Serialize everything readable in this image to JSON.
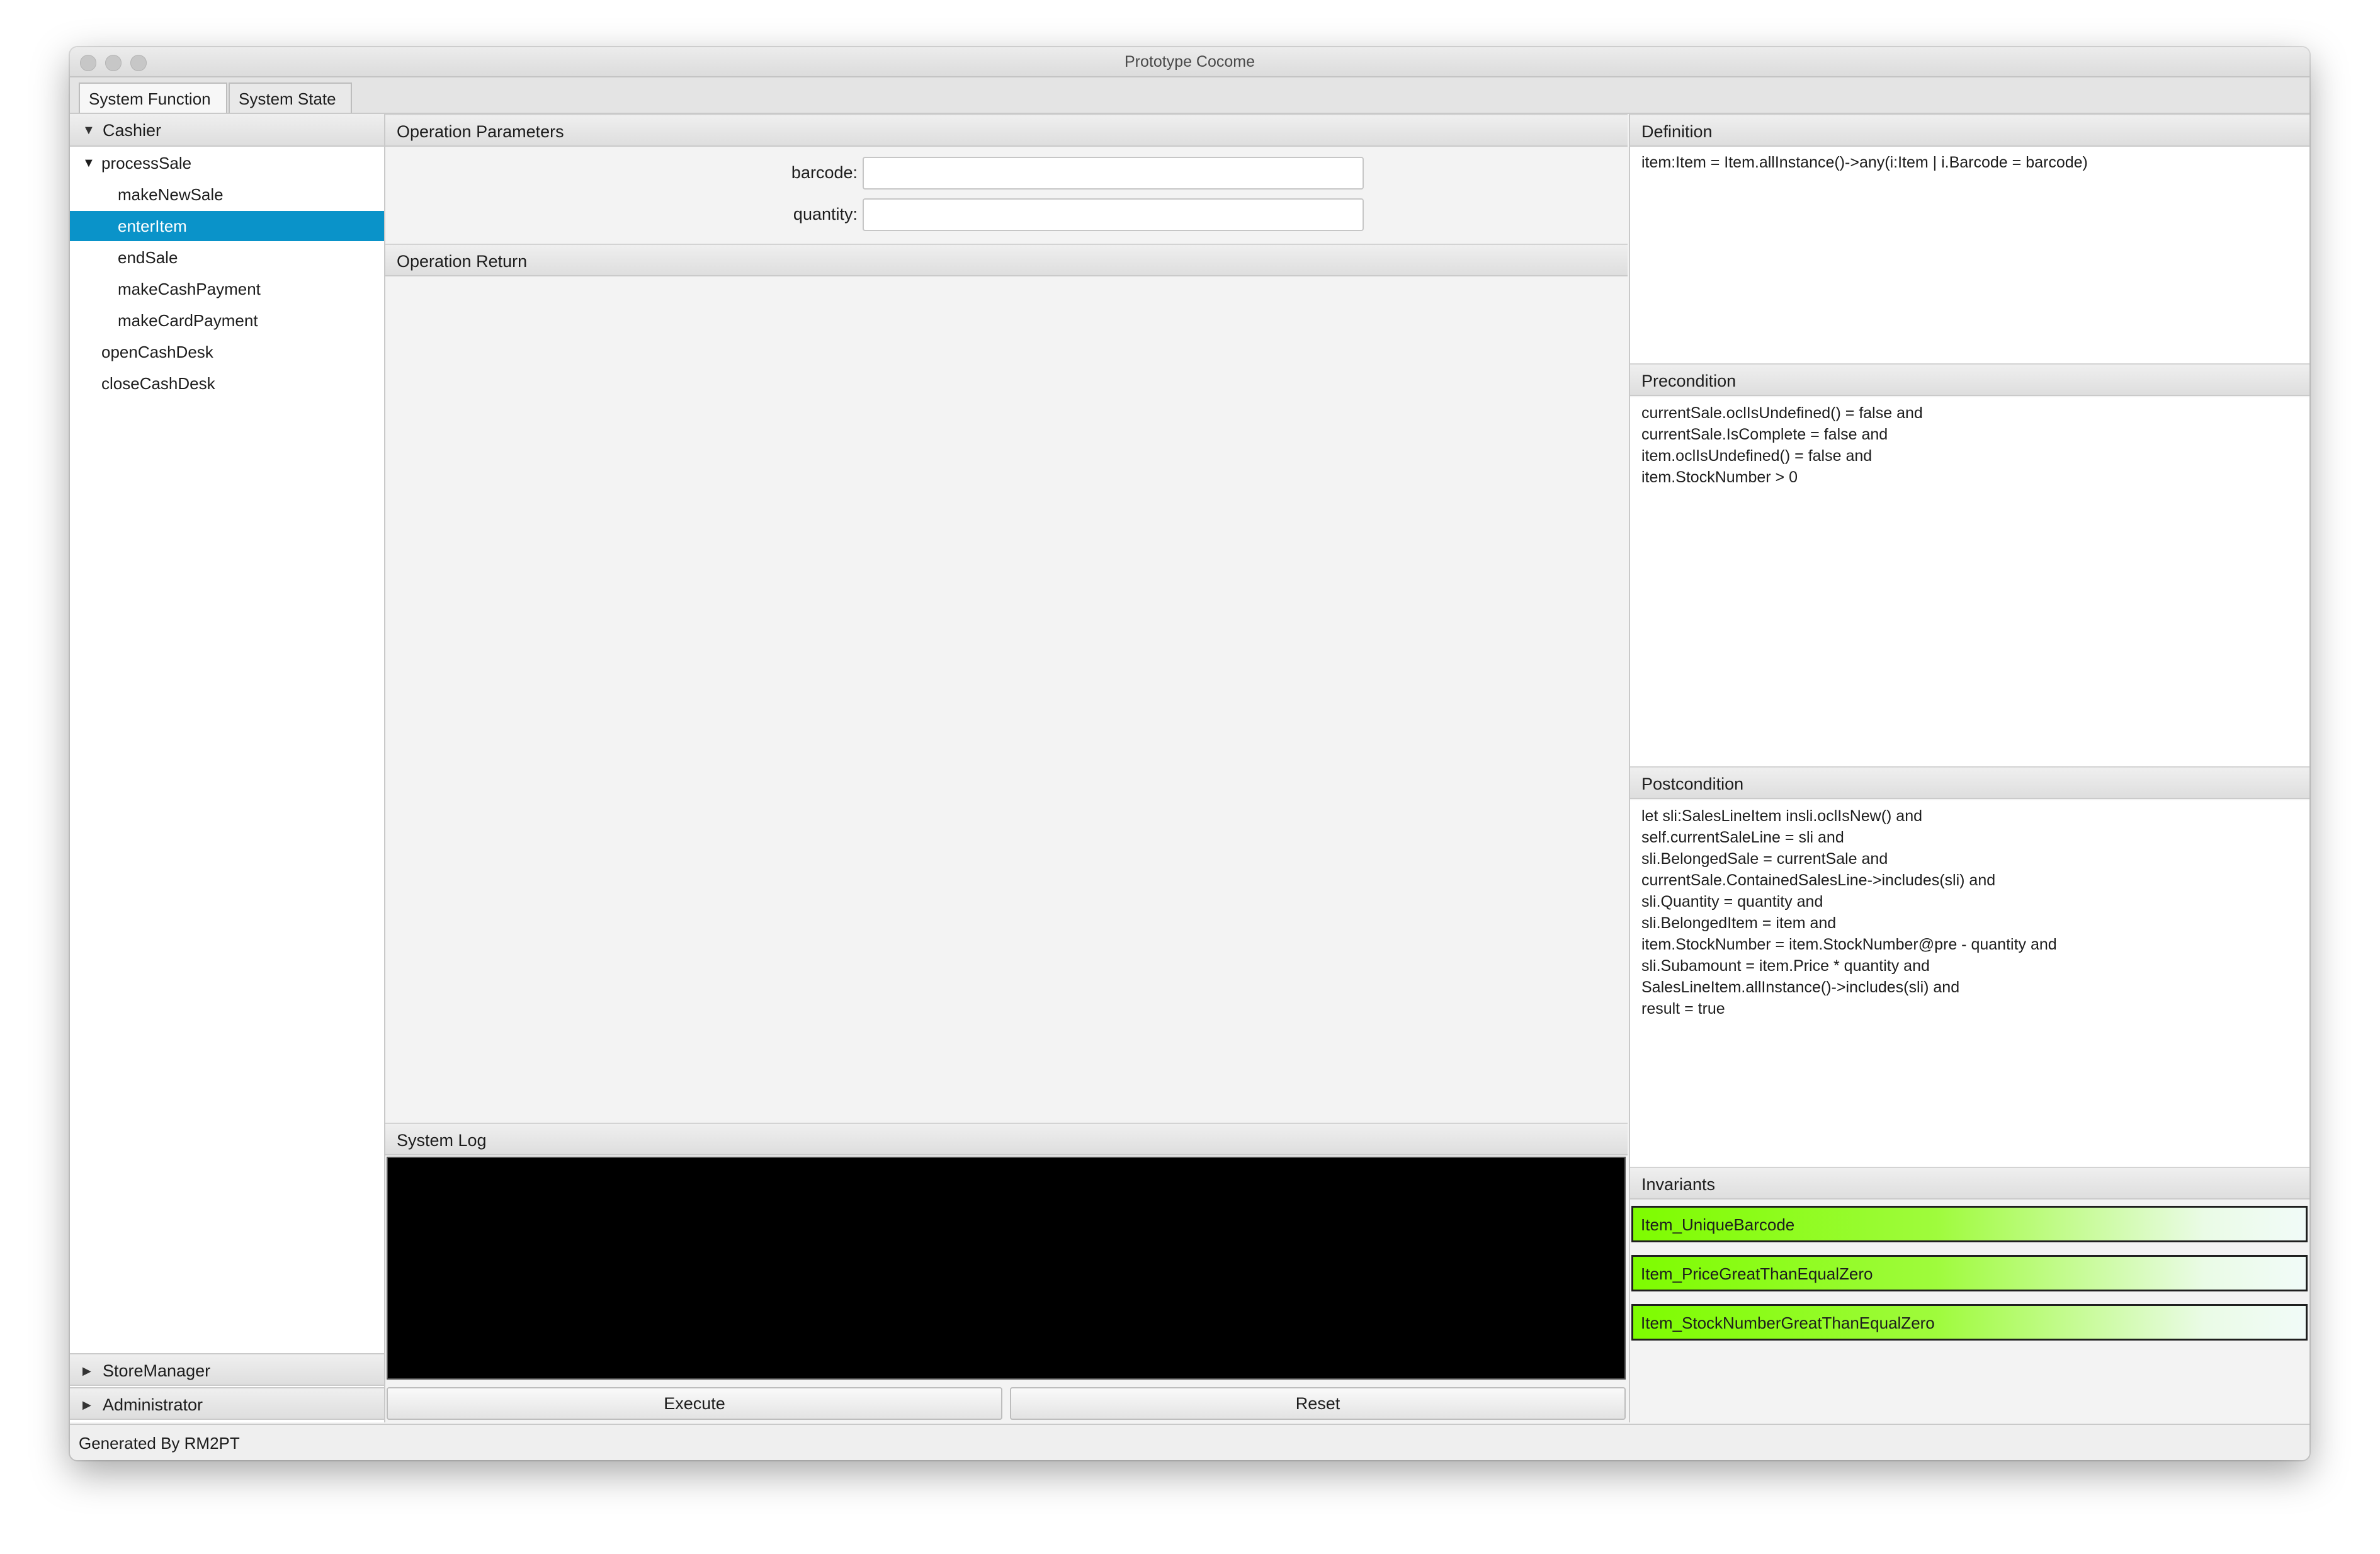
{
  "window": {
    "title": "Prototype Cocome"
  },
  "tabs": [
    {
      "label": "System Function",
      "active": true
    },
    {
      "label": "System State",
      "active": false
    }
  ],
  "tree": {
    "cashier": "Cashier",
    "processSale": "processSale",
    "items": [
      "makeNewSale",
      "enterItem",
      "endSale",
      "makeCashPayment",
      "makeCardPayment"
    ],
    "selected": "enterItem",
    "openCashDesk": "openCashDesk",
    "closeCashDesk": "closeCashDesk",
    "storeManager": "StoreManager",
    "administrator": "Administrator"
  },
  "operation": {
    "parameters_title": "Operation Parameters",
    "barcode_label": "barcode:",
    "barcode_value": "",
    "quantity_label": "quantity:",
    "quantity_value": "",
    "return_title": "Operation Return",
    "log_title": "System Log",
    "execute": "Execute",
    "reset": "Reset"
  },
  "definition": {
    "title": "Definition",
    "text": "item:Item = Item.allInstance()->any(i:Item | i.Barcode = barcode)"
  },
  "precondition": {
    "title": "Precondition",
    "text": "currentSale.oclIsUndefined() = false and\ncurrentSale.IsComplete = false and\nitem.oclIsUndefined() = false and\nitem.StockNumber > 0"
  },
  "postcondition": {
    "title": "Postcondition",
    "text": "let sli:SalesLineItem insli.oclIsNew() and\nself.currentSaleLine = sli and\nsli.BelongedSale = currentSale and\ncurrentSale.ContainedSalesLine->includes(sli) and\nsli.Quantity = quantity and\nsli.BelongedItem = item and\nitem.StockNumber = item.StockNumber@pre - quantity and\nsli.Subamount = item.Price * quantity and\nSalesLineItem.allInstance()->includes(sli) and\nresult = true"
  },
  "invariants": {
    "title": "Invariants",
    "items": [
      "Item_UniqueBarcode",
      "Item_PriceGreatThanEqualZero",
      "Item_StockNumberGreatThanEqualZero"
    ]
  },
  "status": "Generated By RM2PT",
  "colors": {
    "selection": "#0a93c9",
    "invariant_ok": "#7efc00",
    "log_bg": "#000000"
  }
}
